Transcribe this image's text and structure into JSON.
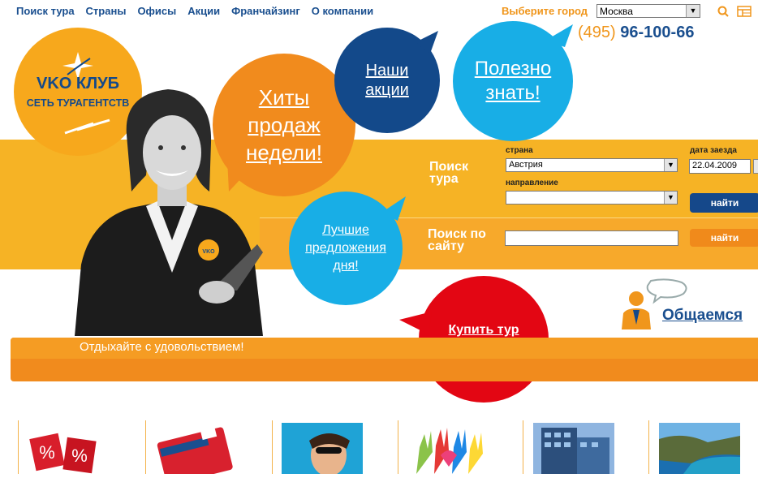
{
  "nav": [
    "Поиск тура",
    "Страны",
    "Офисы",
    "Акции",
    "Франчайзинг",
    "О компании"
  ],
  "city": {
    "label": "Выберите город",
    "value": "Москва"
  },
  "phone": {
    "code": "(495)",
    "number": "96-100-66"
  },
  "logo": {
    "brand": "VKO КЛУБ",
    "sub": "СЕТЬ ТУРАГЕНТСТВ"
  },
  "bubbles": {
    "hits": "Хиты продаж недели!",
    "actions": "Наши акции",
    "useful": "Полезно знать!",
    "best": "Лучшие предложения дня!",
    "buy": "Купить тур легко и быстро!"
  },
  "tour_search": {
    "title": "Поиск тура",
    "country_label": "страна",
    "country_value": "Австрия",
    "direction_label": "направление",
    "direction_value": "",
    "date_label": "дата заезда",
    "date_value": "22.04.2009",
    "button": "найти"
  },
  "site_search": {
    "title": "Поиск по сайту",
    "value": "",
    "button": "найти"
  },
  "chat": {
    "label": "Общаемся"
  },
  "tagline": "Отдыхайте с удовольствием!",
  "badge": "VKO",
  "colors": {
    "brand_blue": "#15488a",
    "orange": "#f18b1d",
    "yellow": "#f6b325",
    "sky": "#18aee6",
    "red": "#e30613"
  }
}
